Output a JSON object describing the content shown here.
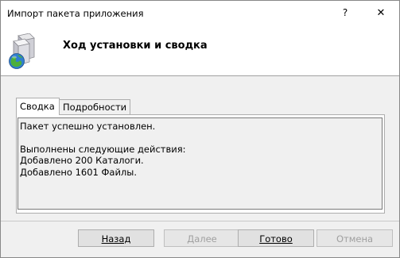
{
  "window": {
    "title": "Импорт пакета приложения",
    "help_glyph": "?",
    "close_glyph": "✕"
  },
  "header": {
    "title": "Ход установки и сводка",
    "icon": "package-install-icon"
  },
  "tabs": [
    {
      "label": "Сводка",
      "active": true
    },
    {
      "label": "Подробности",
      "active": false
    }
  ],
  "summary": {
    "lines": [
      "Пакет успешно установлен.",
      "",
      "Выполнены следующие действия:",
      "Добавлено 200 Каталоги.",
      "Добавлено 1601 Файлы."
    ]
  },
  "buttons": {
    "back": {
      "label": "Назад",
      "enabled": true
    },
    "next": {
      "label": "Далее",
      "enabled": false
    },
    "finish": {
      "label": "Готово",
      "enabled": true
    },
    "cancel": {
      "label": "Отмена",
      "enabled": false
    }
  },
  "colors": {
    "window_bg": "#f0f0f0",
    "header_bg": "#ffffff",
    "disabled_text": "#a0a0a0"
  }
}
